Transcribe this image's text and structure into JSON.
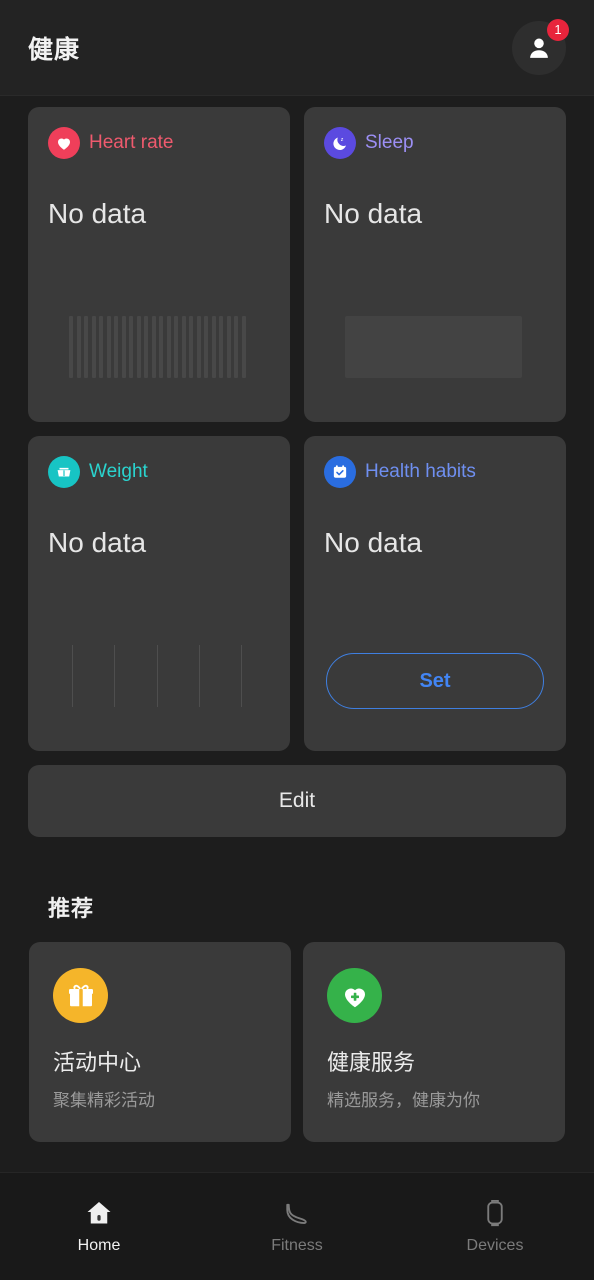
{
  "header": {
    "title": "健康",
    "avatar_icon": "person-icon",
    "badge_count": "1"
  },
  "metrics": [
    {
      "key": "heart-rate",
      "label": "Heart rate",
      "value": "No data",
      "icon": "heart-icon",
      "color": "#ef3f5a",
      "placeholder": "bars"
    },
    {
      "key": "sleep",
      "label": "Sleep",
      "value": "No data",
      "icon": "moon-icon",
      "color": "#5b4ae0",
      "placeholder": "rect"
    },
    {
      "key": "weight",
      "label": "Weight",
      "value": "No data",
      "icon": "scale-icon",
      "color": "#17c4c4",
      "placeholder": "lines"
    },
    {
      "key": "health-habits",
      "label": "Health habits",
      "value": "No data",
      "icon": "calendar-check-icon",
      "color": "#2a6de0",
      "placeholder": "button",
      "action_label": "Set"
    }
  ],
  "edit": {
    "label": "Edit"
  },
  "recommend": {
    "section_title": "推荐",
    "cards": [
      {
        "title": "活动中心",
        "subtitle": "聚集精彩活动",
        "icon": "gift-icon",
        "color": "#f5b52a"
      },
      {
        "title": "健康服务",
        "subtitle": "精选服务，健康为你",
        "icon": "heart-plus-icon",
        "color": "#35b24a"
      }
    ]
  },
  "tabbar": {
    "items": [
      {
        "label": "Home",
        "icon": "home-icon",
        "active": true
      },
      {
        "label": "Fitness",
        "icon": "shoe-icon",
        "active": false
      },
      {
        "label": "Devices",
        "icon": "watch-icon",
        "active": false
      }
    ]
  },
  "colors": {
    "background": "#1d1d1d",
    "card": "#3a3a3a",
    "header": "#232323",
    "tabbar": "#191919",
    "accent_blue": "#4285f4",
    "badge_red": "#e8243c"
  }
}
